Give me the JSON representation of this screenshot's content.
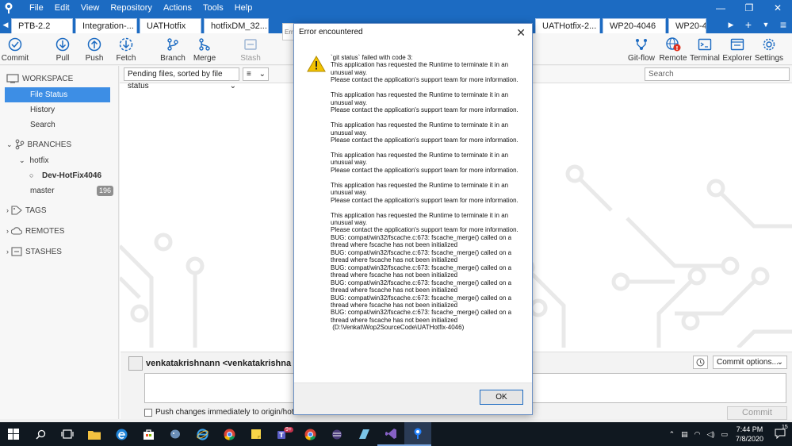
{
  "menu": [
    "File",
    "Edit",
    "View",
    "Repository",
    "Actions",
    "Tools",
    "Help"
  ],
  "tabs": [
    "PTB-2.2",
    "Integration-...",
    "UATHotfix",
    "hotfixDM_32...",
    "UATHotfix-2...",
    "WP20-4046",
    "WP20-41"
  ],
  "toolbar": {
    "commit": "Commit",
    "pull": "Pull",
    "push": "Push",
    "fetch": "Fetch",
    "branch": "Branch",
    "merge": "Merge",
    "stash": "Stash",
    "gitflow": "Git-flow",
    "remote": "Remote",
    "terminal": "Terminal",
    "explorer": "Explorer",
    "settings": "Settings"
  },
  "sidebar": {
    "workspace": "WORKSPACE",
    "file_status": "File Status",
    "history": "History",
    "search": "Search",
    "branches": "BRANCHES",
    "hotfix": "hotfix",
    "current_branch": "Dev-HotFix4046",
    "master": "master",
    "master_badge": "196",
    "tags": "TAGS",
    "remotes": "REMOTES",
    "stashes": "STASHES"
  },
  "content": {
    "pending_select": "Pending files, sorted by file status",
    "view_select": "≡",
    "search_placeholder": "Search"
  },
  "commit_panel": {
    "author": "venkatakrishnann <venkatakrishna",
    "options": "Commit options...",
    "push_label": "Push changes immediately to origin/hotf",
    "commit_button": "Commit"
  },
  "dialog": {
    "title": "Error encountered",
    "ghost_title": "Err",
    "ok": "OK",
    "message": "`git status` failed with code 3:\nThis application has requested the Runtime to terminate it in an unusual way.\nPlease contact the application's support team for more information.\n\nThis application has requested the Runtime to terminate it in an unusual way.\nPlease contact the application's support team for more information.\n\nThis application has requested the Runtime to terminate it in an unusual way.\nPlease contact the application's support team for more information.\n\nThis application has requested the Runtime to terminate it in an unusual way.\nPlease contact the application's support team for more information.\n\nThis application has requested the Runtime to terminate it in an unusual way.\nPlease contact the application's support team for more information.\n\nThis application has requested the Runtime to terminate it in an unusual way.\nPlease contact the application's support team for more information.\nBUG: compat/win32/fscache.c:673: fscache_merge() called on a thread where fscache has not been initialized\nBUG: compat/win32/fscache.c:673: fscache_merge() called on a thread where fscache has not been initialized\nBUG: compat/win32/fscache.c:673: fscache_merge() called on a thread where fscache has not been initialized\nBUG: compat/win32/fscache.c:673: fscache_merge() called on a thread where fscache has not been initialized\nBUG: compat/win32/fscache.c:673: fscache_merge() called on a thread where fscache has not been initialized\nBUG: compat/win32/fscache.c:673: fscache_merge() called on a thread where fscache has not been initialized\n (D:\\Venkat\\Wop2SourceCode\\UATHotfix-4046)"
  },
  "taskbar": {
    "time": "7:44 PM",
    "date": "7/8/2020",
    "notification_count": "15",
    "teams_badge": "9+"
  },
  "colors": {
    "title_blue": "#1c6bc2",
    "selected_blue": "#3d8ee5",
    "warning_yellow": "#f2c200"
  }
}
